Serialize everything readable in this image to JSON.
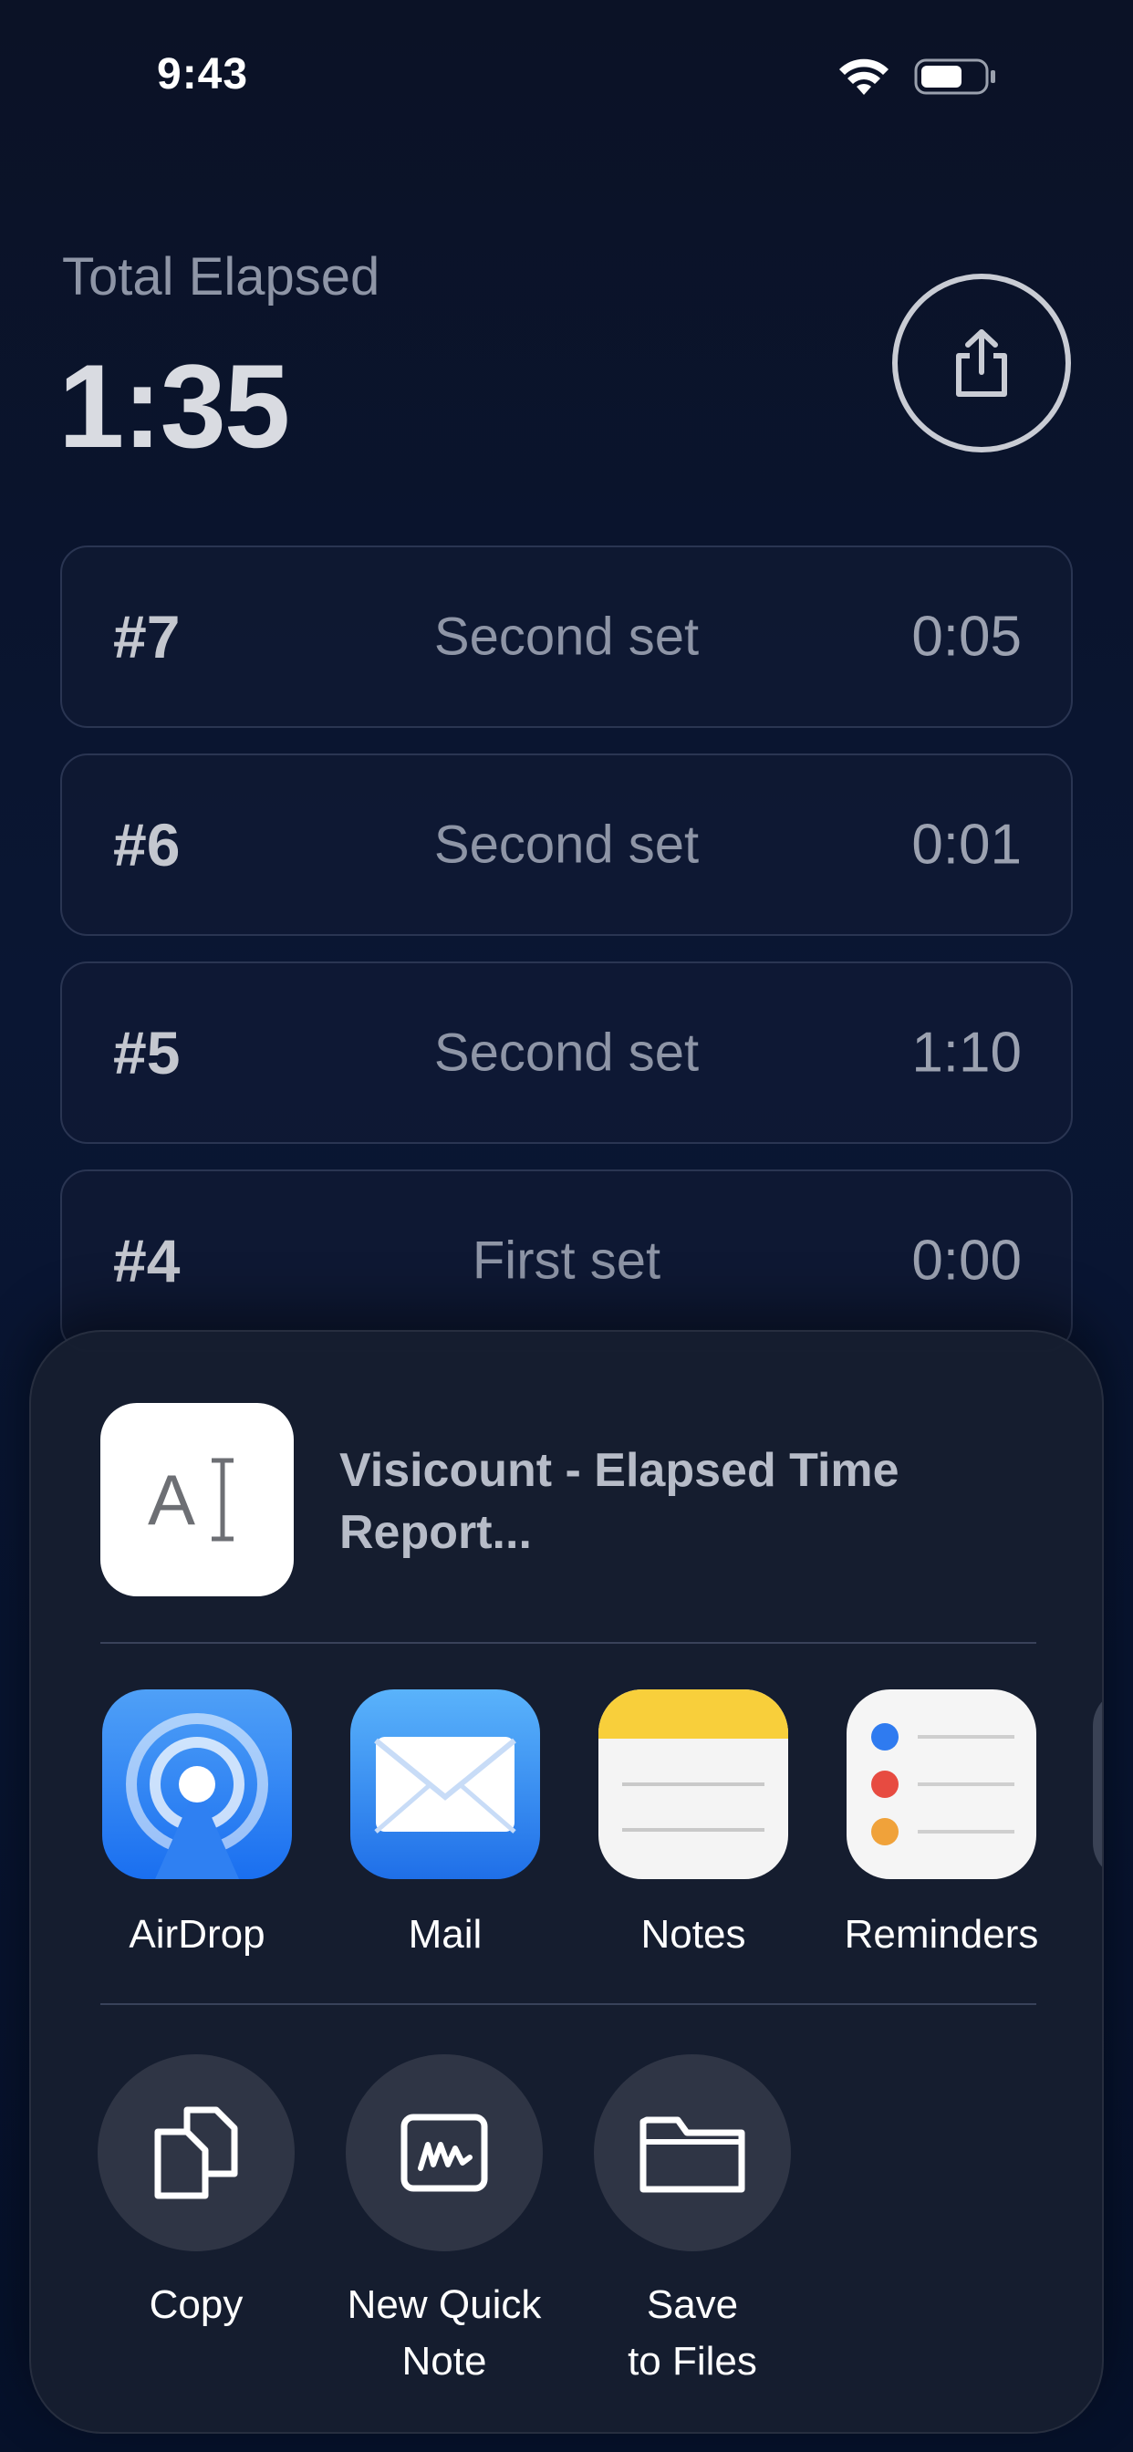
{
  "status_bar": {
    "time": "9:43",
    "icons": [
      "wifi-icon",
      "battery-icon"
    ]
  },
  "header": {
    "label": "Total Elapsed",
    "value": "1:35",
    "share_icon": "share-icon"
  },
  "rows": [
    {
      "num": "#7",
      "label": "Second set",
      "time": "0:05"
    },
    {
      "num": "#6",
      "label": "Second set",
      "time": "0:01"
    },
    {
      "num": "#5",
      "label": "Second set",
      "time": "1:10"
    },
    {
      "num": "#4",
      "label": "First set",
      "time": "0:00"
    }
  ],
  "share_sheet": {
    "preview": {
      "title": "Visicount - Elapsed Time Report...",
      "thumb_text": "A"
    },
    "apps": [
      {
        "label": "AirDrop",
        "icon": "airdrop-icon"
      },
      {
        "label": "Mail",
        "icon": "mail-icon"
      },
      {
        "label": "Notes",
        "icon": "notes-icon"
      },
      {
        "label": "Reminders",
        "icon": "reminders-icon"
      }
    ],
    "actions": [
      {
        "label": "Copy",
        "icon": "copy-icon"
      },
      {
        "label": "New Quick Note",
        "icon": "quick-note-icon"
      },
      {
        "label": "Save to Files",
        "icon": "folder-icon"
      }
    ]
  }
}
